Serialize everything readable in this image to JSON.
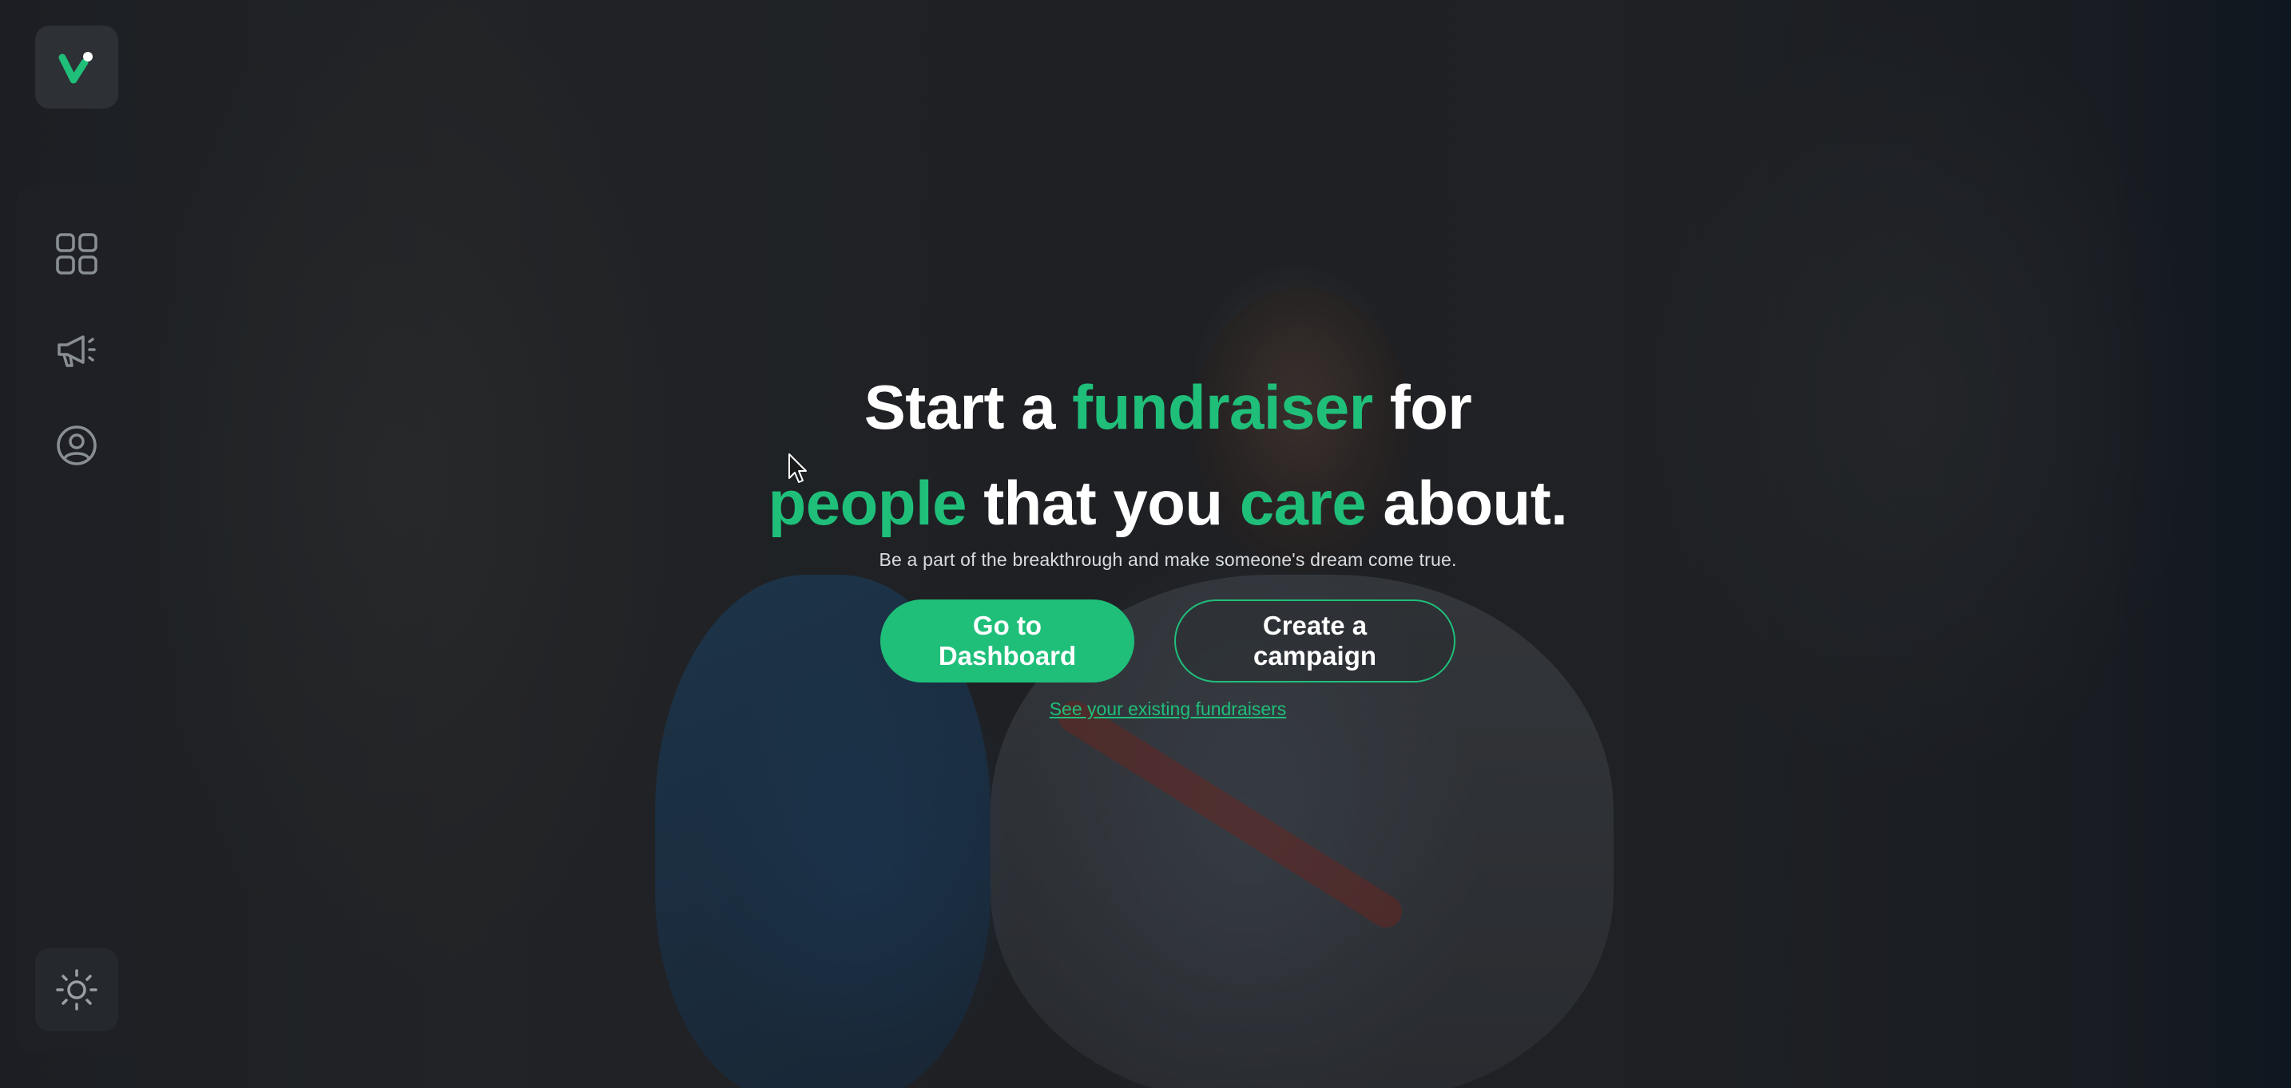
{
  "hero": {
    "headline_line1": {
      "part1": "Start a ",
      "accent1": "fundraiser",
      "part2": " for"
    },
    "headline_line2": {
      "accent1": "people",
      "part1": " that you ",
      "accent2": "care",
      "part2": " about."
    },
    "subtitle": "Be a part of the breakthrough and make someone's dream come true.",
    "primary_button": "Go to Dashboard",
    "secondary_button": "Create a campaign",
    "existing_link": "See your existing fundraisers"
  },
  "sidebar": {
    "items": [
      {
        "icon": "grid-icon"
      },
      {
        "icon": "megaphone-icon"
      },
      {
        "icon": "user-circle-icon"
      }
    ],
    "theme_toggle_icon": "sun-icon"
  },
  "colors": {
    "accent": "#1fbf7a",
    "sidebar_bg": "#1e2025",
    "tile_bg": "#2d3034"
  }
}
